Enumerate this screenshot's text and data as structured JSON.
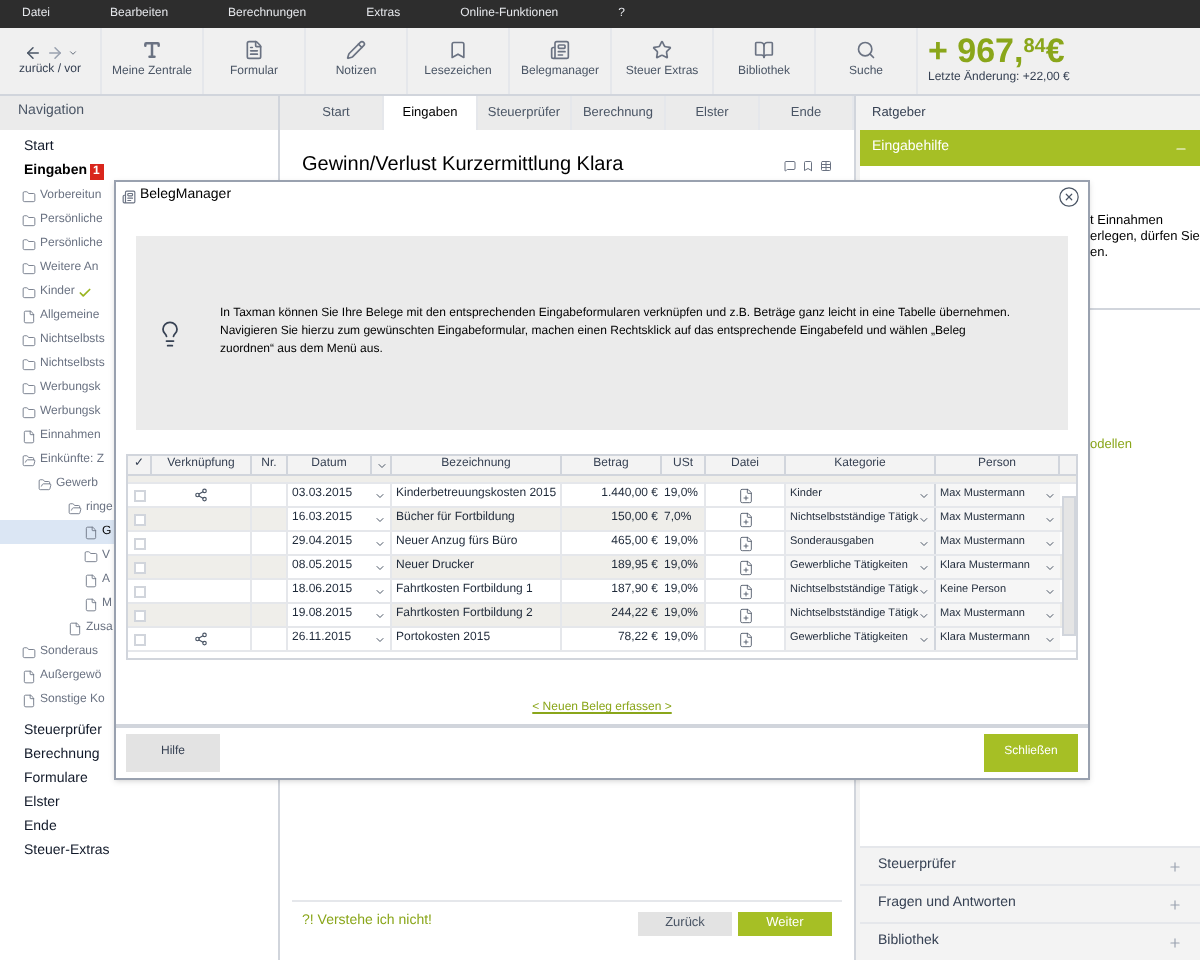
{
  "menu": [
    "Datei",
    "Bearbeiten",
    "Berechnungen",
    "Extras",
    "Online-Funktionen",
    "?"
  ],
  "toolbar": {
    "nav_label": "zurück / vor",
    "items": [
      {
        "kind": "text",
        "label": "Meine Zentrale"
      },
      {
        "kind": "form",
        "label": "Formular"
      },
      {
        "kind": "pencil",
        "label": "Notizen"
      },
      {
        "kind": "bookmark",
        "label": "Lesezeichen"
      },
      {
        "kind": "receipts",
        "label": "Belegmanager"
      },
      {
        "kind": "star",
        "label": "Steuer Extras"
      },
      {
        "kind": "book",
        "label": "Bibliothek"
      },
      {
        "kind": "search",
        "label": "Suche"
      }
    ],
    "refund": "+ 967,$^{84}$€",
    "last_change": "Letzte Änderung: +22,00 €"
  },
  "navigation": {
    "title": "Navigation",
    "items": [
      {
        "label": "Start",
        "selected": false
      },
      {
        "label": "Eingaben",
        "badge": "1",
        "selected": true,
        "children": [
          {
            "label": "Vorbereitun",
            "kind": "folder",
            "selected": false
          },
          {
            "label": "Persönliche",
            "kind": "folder",
            "selected": false
          },
          {
            "label": "Persönliche",
            "kind": "folder",
            "selected": false
          },
          {
            "label": "Weitere An",
            "kind": "folder",
            "selected": false
          },
          {
            "label": "Kinder",
            "kind": "folder",
            "done": true,
            "selected": false
          },
          {
            "label": "Allgemeine",
            "kind": "file",
            "selected": false
          },
          {
            "label": "Nichtselbsts",
            "kind": "folder",
            "selected": false
          },
          {
            "label": "Nichtselbsts",
            "kind": "folder",
            "selected": false
          },
          {
            "label": "Werbungsk",
            "kind": "folder",
            "selected": false
          },
          {
            "label": "Werbungsk",
            "kind": "folder",
            "selected": false
          },
          {
            "label": "Einnahmen",
            "kind": "file",
            "selected": false
          },
          {
            "label": "Einkünfte: Z",
            "kind": "open-folder",
            "selected": false,
            "children": [
              {
                "label": "Gewerb",
                "kind": "open-folder",
                "selected": false,
                "children": [
                  {
                    "label": "ringe",
                    "kind": "open-folder",
                    "selected": false,
                    "children": [
                      {
                        "label": "G",
                        "kind": "file",
                        "selected": true
                      },
                      {
                        "label": "V",
                        "kind": "folder",
                        "selected": false
                      },
                      {
                        "label": "A",
                        "kind": "file",
                        "selected": false
                      },
                      {
                        "label": "M",
                        "kind": "file",
                        "selected": false
                      }
                    ]
                  },
                  {
                    "label": "Zusa",
                    "kind": "file",
                    "selected": false
                  }
                ]
              }
            ]
          },
          {
            "label": "Sonderaus",
            "kind": "folder",
            "selected": false
          },
          {
            "label": "Außergewö",
            "kind": "file",
            "selected": false
          },
          {
            "label": "Sonstige Ko",
            "kind": "file",
            "selected": false
          }
        ]
      },
      {
        "label": "Steuerprüfer",
        "selected": false
      },
      {
        "label": "Berechnung",
        "selected": false
      },
      {
        "label": "Formulare",
        "selected": false
      },
      {
        "label": "Elster",
        "selected": false
      },
      {
        "label": "Ende",
        "selected": false
      },
      {
        "label": "Steuer-Extras",
        "selected": false
      }
    ]
  },
  "tabs": [
    {
      "label": "Start",
      "selected": false
    },
    {
      "label": "Eingaben",
      "selected": true
    },
    {
      "label": "Steuerprüfer",
      "selected": false
    },
    {
      "label": "Berechnung",
      "selected": false
    },
    {
      "label": "Elster",
      "selected": false
    },
    {
      "label": "Ende",
      "selected": false
    }
  ],
  "form": {
    "title": "Gewinn/Verlust Kurzermittlung Klara",
    "help_link": "?! Verstehe ich nicht!",
    "back": "Zurück",
    "next": "Weiter"
  },
  "advisor": {
    "title": "Ratgeber",
    "panel": "Eingabehilfe",
    "text": [
      "t Einnahmen",
      "erlegen, dürfen Sie",
      "en."
    ],
    "link": "odellen",
    "sections": [
      "Steuerprüfer",
      "Fragen und Antworten",
      "Bibliothek"
    ]
  },
  "dialog": {
    "title": "BelegManager",
    "info": "In Taxman können Sie Ihre Belege mit den entsprechenden Eingabeformularen verknüpfen und z.B. Beträge ganz leicht in eine Tabelle übernehmen. Navigieren Sie hierzu zum gewünschten Eingabeformular, machen einen Rechtsklick auf das entsprechende Eingabefeld und wählen „Beleg zuordnen“ aus dem Menü aus.",
    "columns": [
      "✓",
      "Verknüpfung",
      "Nr.",
      "Datum",
      "Bezeichnung",
      "Betrag",
      "USt",
      "Datei",
      "Kategorie",
      "Person"
    ],
    "rows": [
      {
        "checked": false,
        "linked": true,
        "date": "03.03.2015",
        "name": "Kinderbetreuungskosten 2015",
        "amount": "1.440,00 €",
        "vat": "19,0%",
        "category": "Kinder",
        "person": "Max Mustermann"
      },
      {
        "checked": false,
        "linked": false,
        "date": "16.03.2015",
        "name": "Bücher für Fortbildung",
        "amount": "150,00 €",
        "vat": "7,0%",
        "category": "Nichtselbstständige Tätigk",
        "person": "Max Mustermann"
      },
      {
        "checked": false,
        "linked": false,
        "date": "29.04.2015",
        "name": "Neuer Anzug fürs Büro",
        "amount": "465,00 €",
        "vat": "19,0%",
        "category": "Sonderausgaben",
        "person": "Max Mustermann"
      },
      {
        "checked": false,
        "linked": false,
        "date": "08.05.2015",
        "name": "Neuer Drucker",
        "amount": "189,95 €",
        "vat": "19,0%",
        "category": "Gewerbliche Tätigkeiten",
        "person": "Klara Mustermann"
      },
      {
        "checked": false,
        "linked": false,
        "date": "18.06.2015",
        "name": "Fahrtkosten Fortbildung 1",
        "amount": "187,90 €",
        "vat": "19,0%",
        "category": "Nichtselbstständige Tätigk",
        "person": "Keine Person"
      },
      {
        "checked": false,
        "linked": false,
        "date": "19.08.2015",
        "name": "Fahrtkosten Fortbildung 2",
        "amount": "244,22 €",
        "vat": "19,0%",
        "category": "Nichtselbstständige Tätigk",
        "person": "Max Mustermann"
      },
      {
        "checked": false,
        "linked": true,
        "date": "26.11.2015",
        "name": "Portokosten 2015",
        "amount": "78,22 €",
        "vat": "19,0%",
        "category": "Gewerbliche Tätigkeiten",
        "person": "Klara Mustermann"
      }
    ],
    "new_link": "< Neuen Beleg erfassen >",
    "help": "Hilfe",
    "close": "Schließen"
  }
}
